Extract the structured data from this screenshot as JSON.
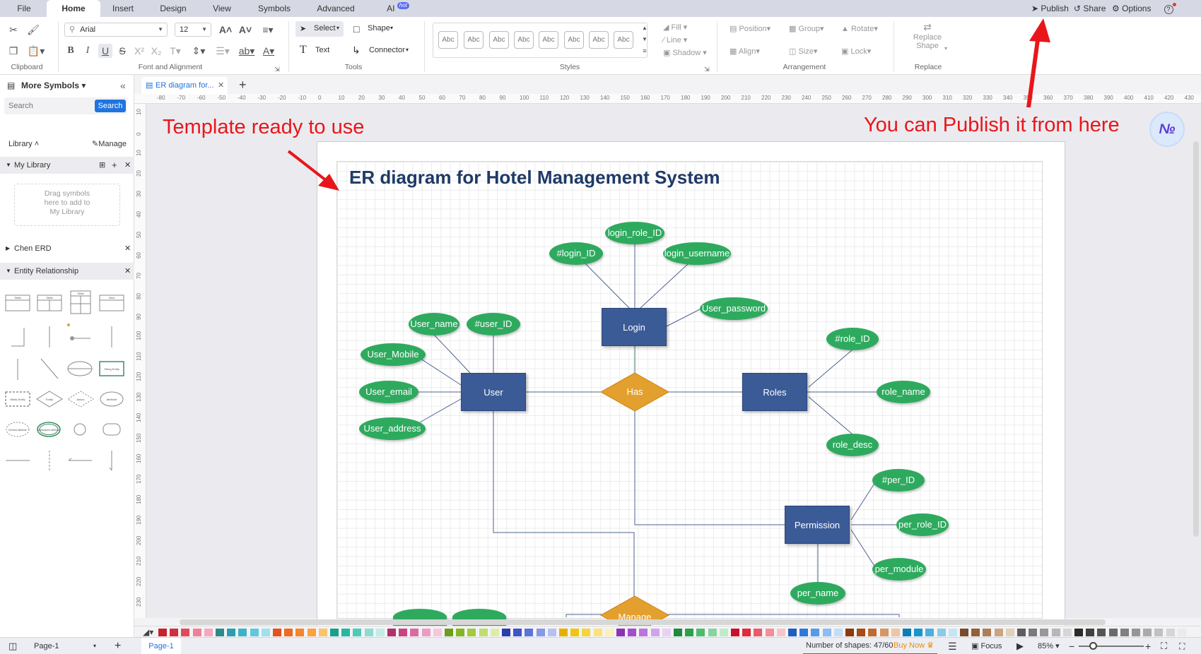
{
  "menu": {
    "tabs": [
      {
        "label": "File"
      },
      {
        "label": "Home",
        "active": true
      },
      {
        "label": "Insert"
      },
      {
        "label": "Design"
      },
      {
        "label": "View"
      },
      {
        "label": "Symbols"
      },
      {
        "label": "Advanced"
      },
      {
        "label": "AI"
      }
    ],
    "ai_badge": "hot",
    "publish": "Publish",
    "share": "Share",
    "options": "Options",
    "help": "?"
  },
  "ribbon": {
    "groups": {
      "clipboard": "Clipboard",
      "font": "Font and Alignment",
      "tools": "Tools",
      "styles": "Styles",
      "arrangement": "Arrangement",
      "replace": "Replace"
    },
    "font_family": "Arial",
    "font_size": "12",
    "select": "Select",
    "shape": "Shape",
    "text": "Text",
    "connector": "Connector",
    "style_preset": "Abc",
    "fill": "Fill",
    "line": "Line",
    "shadow": "Shadow",
    "position": "Position",
    "group": "Group",
    "rotate": "Rotate",
    "align": "Align",
    "size": "Size",
    "lock": "Lock",
    "replace_shape_1": "Replace",
    "replace_shape_2": "Shape"
  },
  "sidebar": {
    "title": "More Symbols",
    "search_placeholder": "Search",
    "search_button": "Search",
    "library": "Library",
    "manage": "Manage",
    "my_library": "My Library",
    "drop_hint_1": "Drag symbols",
    "drop_hint_2": "here to add to",
    "drop_hint_3": "My Library",
    "chen_erd": "Chen ERD",
    "entity_relationship": "Entity Relationship",
    "symbol_labels": [
      "Table",
      "Table",
      "Table",
      "View",
      "Weak Entity",
      "Entity",
      "Assoc",
      "Attribute",
      "Derived attribute",
      "Multivalued attribute",
      "String Entity"
    ]
  },
  "document_tab": {
    "label": "ER diagram for..."
  },
  "ruler": {
    "h": [
      "-80",
      "-70",
      "-60",
      "-50",
      "-40",
      "-30",
      "-20",
      "-10",
      "0",
      "10",
      "20",
      "30",
      "40",
      "50",
      "60",
      "70",
      "80",
      "90",
      "100",
      "110",
      "120",
      "130",
      "140",
      "150",
      "160",
      "170",
      "180",
      "190",
      "200",
      "210",
      "220",
      "230",
      "240",
      "250",
      "260",
      "270",
      "280",
      "290",
      "300",
      "310",
      "320",
      "330",
      "340",
      "350",
      "360",
      "370",
      "380",
      "390",
      "400",
      "410",
      "420",
      "430"
    ],
    "v": [
      "10",
      "0",
      "10",
      "20",
      "30",
      "40",
      "50",
      "60",
      "70",
      "80",
      "90",
      "100",
      "110",
      "120",
      "130",
      "140",
      "150",
      "160",
      "170",
      "180",
      "190",
      "200",
      "210",
      "220",
      "230"
    ]
  },
  "diagram": {
    "title": "ER diagram for Hotel Management System",
    "entities": {
      "login": "Login",
      "user": "User",
      "roles": "Roles",
      "permission": "Permission"
    },
    "relationships": {
      "has": "Has",
      "manage": "Manage"
    },
    "attributes": {
      "login_role_id": "login_role_ID",
      "login_id": "#login_ID",
      "login_username": "login_username",
      "user_password": "User_password",
      "user_name": "User_name",
      "user_id": "#user_ID",
      "user_mobile": "User_Mobile",
      "user_email": "User_email",
      "user_address": "User_address",
      "role_id": "#role_ID",
      "role_name": "role_name",
      "role_desc": "role_desc",
      "per_id": "#per_ID",
      "per_role_id": "per_role_ID",
      "per_module": "per_module",
      "per_name": "per_name"
    },
    "colors": {
      "entity": "#3b5b97",
      "attribute": "#2eaa5e",
      "relationship": "#e4a02e"
    }
  },
  "annotations": {
    "template": "Template ready to use",
    "publish_hint": "You can Publish it from here",
    "color": "#e8161b"
  },
  "status": {
    "page_selector": "Page-1",
    "page_tab": "Page-1",
    "shapes_count": "Number of shapes: 47/60",
    "buy_now": "Buy Now",
    "focus": "Focus",
    "zoom": "85%"
  },
  "palette": [
    "#c7222c",
    "#d02f3d",
    "#e34a59",
    "#f0809a",
    "#f5a8c0",
    "#2d8a8c",
    "#2a9fb0",
    "#3bb3c9",
    "#5fc8dc",
    "#9ee1ec",
    "#e2531f",
    "#ef6a22",
    "#f5862a",
    "#f9a23f",
    "#fbc36a",
    "#17a08c",
    "#26b7a0",
    "#4fcab6",
    "#8ddccf",
    "#bfeee5",
    "#b0316b",
    "#c9447f",
    "#dc6aa0",
    "#ec9cc2",
    "#f5c7dc",
    "#6e9d1c",
    "#84b723",
    "#a1ca3e",
    "#c0dd6e",
    "#dcedaa",
    "#2a3eae",
    "#3c55c8",
    "#5c73db",
    "#8798e6",
    "#b6c1f1",
    "#e7b000",
    "#f1c40f",
    "#f6d43b",
    "#f9e37a",
    "#fcf0b7",
    "#8a34b5",
    "#a24dcc",
    "#b975dc",
    "#d2a3ea",
    "#e9d0f5",
    "#1e8a3c",
    "#2aa14d",
    "#4fbb6c",
    "#87d49c",
    "#c0ebcb",
    "#c8102e",
    "#e02b3d",
    "#ea5a68",
    "#f28f99",
    "#f8c4c9",
    "#1f5fbf",
    "#2f77d9",
    "#579aea",
    "#8dbdf2",
    "#c3ddf9",
    "#8b3a0e",
    "#a64c17",
    "#c06a30",
    "#d79563",
    "#ecc6a5",
    "#0b7fb3",
    "#1696cf",
    "#4bb0de",
    "#8acbea",
    "#c4e5f4",
    "#7a4b2a",
    "#936039",
    "#ae7d56",
    "#c9a584",
    "#e3cfb8",
    "#5e5e5e",
    "#7a7a7a",
    "#989898",
    "#b7b7b7",
    "#d6d6d6",
    "#2b2b2b",
    "#404040",
    "#555555",
    "#6a6a6a",
    "#808080",
    "#959595",
    "#ababab",
    "#c0c0c0",
    "#d5d5d5",
    "#eaeaea"
  ]
}
